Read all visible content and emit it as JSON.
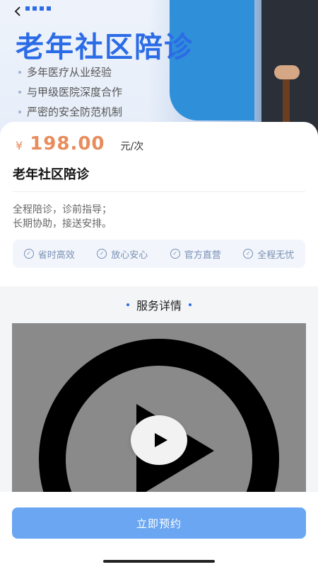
{
  "hero": {
    "title": "老年社区陪诊",
    "bullets": [
      "多年医疗从业经验",
      "与甲级医院深度合作",
      "严密的安全防范机制"
    ]
  },
  "price": {
    "symbol": "¥",
    "amount": "198.00",
    "unit": "元/次"
  },
  "service": {
    "title": "老年社区陪诊",
    "desc_lines": [
      "全程陪诊，诊前指导；",
      "长期协助，接送安排。"
    ]
  },
  "tags": [
    "省时高效",
    "放心安心",
    "官方直营",
    "全程无忧"
  ],
  "detail": {
    "section_title": "服务详情"
  },
  "cta": {
    "label": "立即预约"
  },
  "colors": {
    "accent": "#2b6ce6",
    "price": "#e88c5c",
    "button": "#6aa6f2"
  }
}
